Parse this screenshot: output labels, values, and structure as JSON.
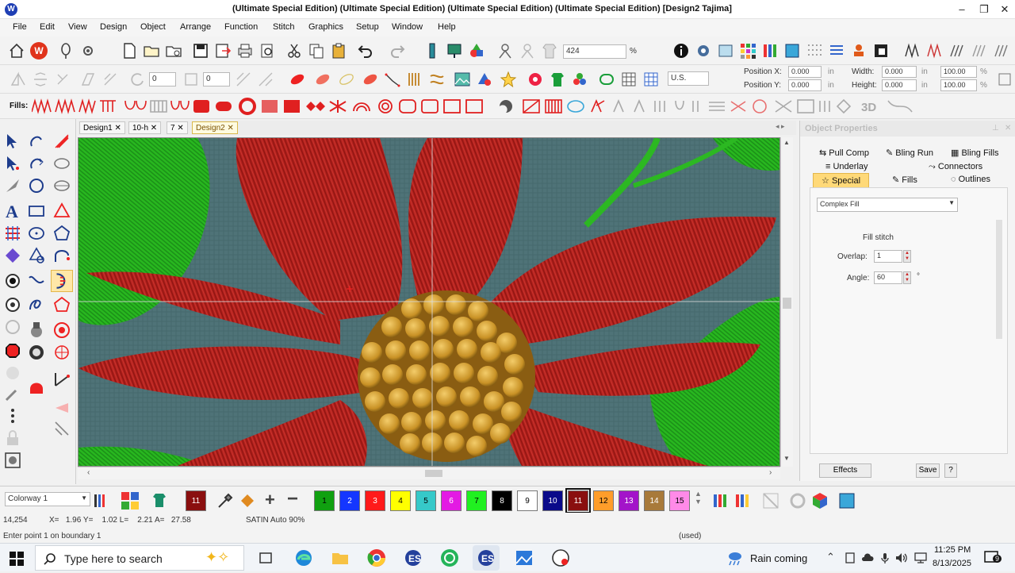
{
  "window": {
    "title": "(Ultimate Special Edition) (Ultimate Special Edition) (Ultimate Special Edition) (Ultimate Special Edition)  [Design2      Tajima]",
    "controls": [
      "–",
      "❐",
      "✕"
    ]
  },
  "menu": [
    "File",
    "Edit",
    "View",
    "Design",
    "Object",
    "Arrange",
    "Function",
    "Stitch",
    "Graphics",
    "Setup",
    "Window",
    "Help"
  ],
  "toolbar": {
    "zoom_value": "424",
    "zoom_unit": "%",
    "units_value": "U.S.",
    "position_x_label": "Position X:",
    "position_y_label": "Position Y:",
    "position_x_value": "0.000",
    "position_y_value": "0.000",
    "width_label": "Width:",
    "height_label": "Height:",
    "width_value": "0.000",
    "height_value": "0.000",
    "unit_in": "in",
    "scale_w": "100.00",
    "scale_h": "100.00",
    "scale_unit": "%",
    "fills_label": "Fills:",
    "stepper_a": "0",
    "stepper_b": "0"
  },
  "document_tabs": [
    "Design1",
    "10-h",
    "7",
    "Design2"
  ],
  "active_tab": "Design2",
  "object_properties": {
    "title": "Object Properties",
    "tabs_row1": [
      "Pull Comp",
      "Bling Run",
      "Bling Fills"
    ],
    "tabs_row2": [
      "Underlay",
      "Connectors"
    ],
    "tabs_row3": [
      "Special",
      "Fills",
      "Outlines"
    ],
    "active_tab": "Special",
    "fill_type": "Complex Fill",
    "section_title": "Fill stitch",
    "overlap_label": "Overlap:",
    "overlap_value": "1",
    "angle_label": "Angle:",
    "angle_value": "60",
    "angle_unit": "°",
    "effects_button": "Effects",
    "save_button": "Save",
    "help_button": "?"
  },
  "palette": {
    "colorway": "Colorway 1",
    "swatches": [
      {
        "label": "1",
        "color": "#10a010",
        "text": "#000"
      },
      {
        "label": "2",
        "color": "#1436ff",
        "text": "#fff"
      },
      {
        "label": "3",
        "color": "#ff1a1a",
        "text": "#fff"
      },
      {
        "label": "4",
        "color": "#ffff00",
        "text": "#000"
      },
      {
        "label": "5",
        "color": "#36c9c9",
        "text": "#000"
      },
      {
        "label": "6",
        "color": "#e31ae3",
        "text": "#fff"
      },
      {
        "label": "7",
        "color": "#21f021",
        "text": "#000"
      },
      {
        "label": "8",
        "color": "#000000",
        "text": "#fff"
      },
      {
        "label": "9",
        "color": "#ffffff",
        "text": "#000"
      },
      {
        "label": "10",
        "color": "#0a0a8a",
        "text": "#fff"
      },
      {
        "label": "11",
        "color": "#8a0f0f",
        "text": "#fff"
      },
      {
        "label": "12",
        "color": "#ff9d2a",
        "text": "#000"
      },
      {
        "label": "13",
        "color": "#a314c9",
        "text": "#fff"
      },
      {
        "label": "14",
        "color": "#a87a3a",
        "text": "#fff"
      },
      {
        "label": "15",
        "color": "#ff8ae8",
        "text": "#000"
      }
    ],
    "current_color_label": "11"
  },
  "status": {
    "stitch_count": "14,254",
    "coords": "X=   1.96 Y=    1.02 L=    2.21 A=   27.58",
    "stitch_type": "SATIN Auto 90%",
    "prompt": "Enter point 1 on boundary 1",
    "used": "(used)"
  },
  "taskbar": {
    "search_placeholder": "Type here to search",
    "weather": "Rain coming",
    "time": "11:25 PM",
    "date": "8/13/2025",
    "notif_count": "9"
  }
}
